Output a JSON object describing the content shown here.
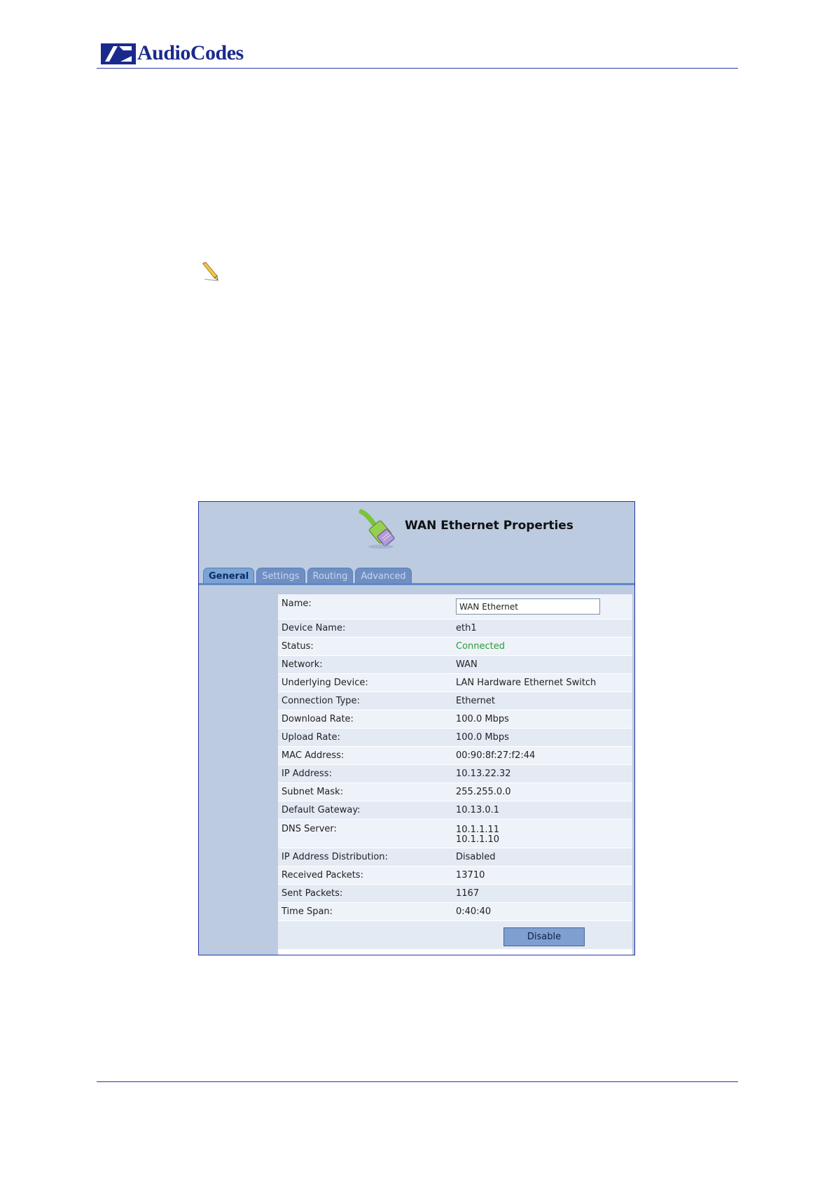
{
  "header": {
    "logo_text": "AudioCodes"
  },
  "panel": {
    "title": "WAN Ethernet Properties",
    "tabs": [
      {
        "label": "General",
        "active": true
      },
      {
        "label": "Settings",
        "active": false
      },
      {
        "label": "Routing",
        "active": false
      },
      {
        "label": "Advanced",
        "active": false
      }
    ],
    "name_label": "Name:",
    "name_value": "WAN Ethernet",
    "rows": [
      {
        "label": "Device Name:",
        "value": "eth1"
      },
      {
        "label": "Status:",
        "value": "Connected"
      },
      {
        "label": "Network:",
        "value": "WAN"
      },
      {
        "label": "Underlying Device:",
        "value": "LAN Hardware Ethernet Switch"
      },
      {
        "label": "Connection Type:",
        "value": "Ethernet"
      },
      {
        "label": "Download Rate:",
        "value": "100.0 Mbps"
      },
      {
        "label": "Upload Rate:",
        "value": "100.0 Mbps"
      },
      {
        "label": "MAC Address:",
        "value": "00:90:8f:27:f2:44"
      },
      {
        "label": "IP Address:",
        "value": "10.13.22.32"
      },
      {
        "label": "Subnet Mask:",
        "value": "255.255.0.0"
      },
      {
        "label": "Default Gateway:",
        "value": "10.13.0.1"
      }
    ],
    "dns": {
      "label": "DNS Server:",
      "values": [
        "10.1.1.11",
        "10.1.1.10"
      ]
    },
    "rows_after": [
      {
        "label": "IP Address Distribution:",
        "value": "Disabled"
      },
      {
        "label": "Received Packets:",
        "value": "13710"
      },
      {
        "label": "Sent Packets:",
        "value": "1167"
      },
      {
        "label": "Time Span:",
        "value": "0:40:40"
      }
    ],
    "disable_button": "Disable"
  },
  "colors": {
    "status_connected": "#2a9b3b",
    "panel_bg": "#bccbe0",
    "brand": "#1a2a8c"
  }
}
